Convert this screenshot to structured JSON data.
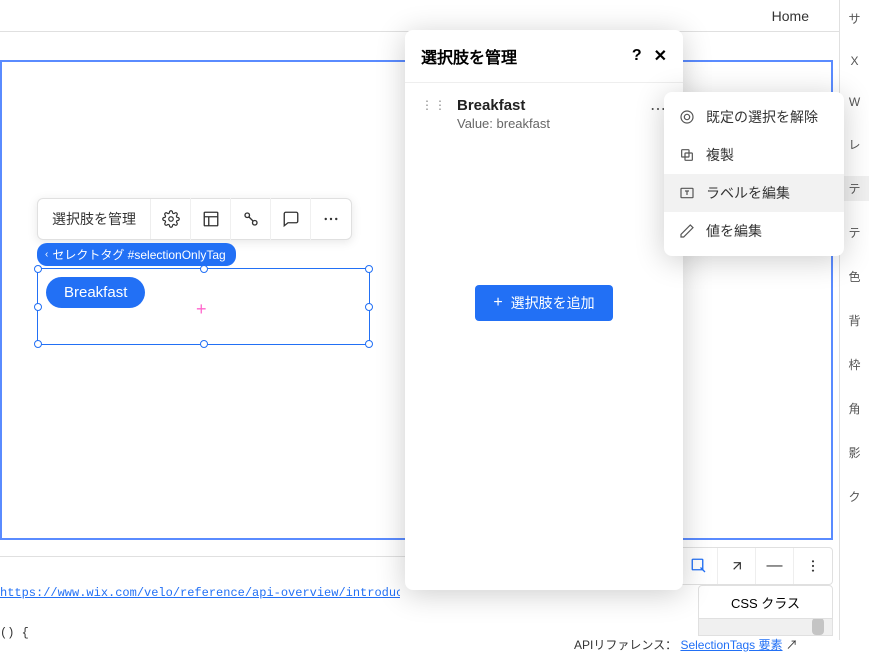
{
  "topbar": {
    "home": "Home"
  },
  "toolbar": {
    "manage": "選択肢を管理"
  },
  "tagBadge": "セレクトタグ #selectionOnlyTag",
  "pill": "Breakfast",
  "modal": {
    "title": "選択肢を管理",
    "item": {
      "label": "Breakfast",
      "value_label": "Value: breakfast"
    },
    "add_button": "選択肢を追加"
  },
  "contextMenu": {
    "clear": "既定の選択を解除",
    "duplicate": "複製",
    "editLabel": "ラベルを編集",
    "editValue": "値を編集"
  },
  "rightPanel": [
    "サ",
    "X",
    "W",
    "レ",
    "テ",
    "テ",
    "色",
    "背",
    "枠",
    "角",
    "影",
    "ク"
  ],
  "cssPanel": "CSS クラス",
  "codeLine": "https://www.wix.com/velo/reference/api-overview/introduction",
  "codeLine2": "() {",
  "apiRef": {
    "prefix": "APIリファレンス：",
    "link": "SelectionTags 要素"
  }
}
